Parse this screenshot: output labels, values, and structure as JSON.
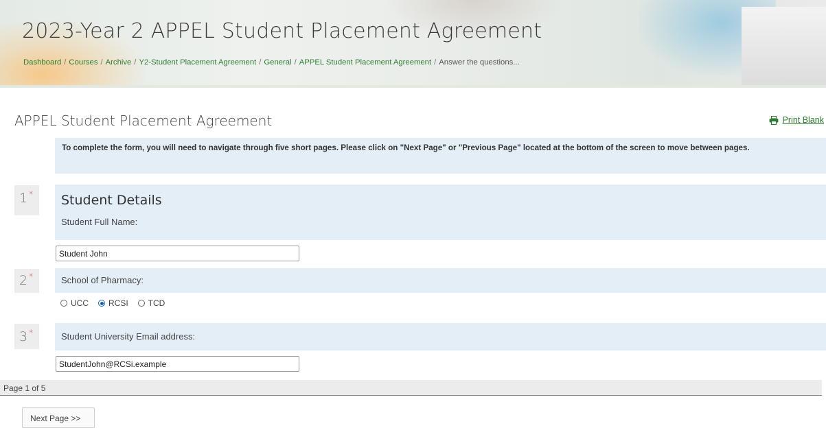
{
  "header": {
    "title": "2023-Year 2 APPEL Student Placement Agreement",
    "breadcrumb": [
      "Dashboard",
      "Courses",
      "Archive",
      "Y2-Student Placement Agreement",
      "General",
      "APPEL Student Placement Agreement",
      "Answer the questions..."
    ],
    "separator": "/"
  },
  "section": {
    "title": "APPEL Student Placement Agreement",
    "print_label": "Print Blank",
    "print_icon": "printer-icon",
    "intro": "To complete the form, you will need to navigate through five short pages. Please click on \"Next Page\" or \"Previous Page\" located at the bottom of the screen to move between pages."
  },
  "questions": [
    {
      "number": "1",
      "required": "*",
      "heading": "Student Details",
      "label": "Student Full Name:",
      "value": "Student John"
    },
    {
      "number": "2",
      "required": "*",
      "label": "School of Pharmacy:",
      "options": [
        "UCC",
        "RCSI",
        "TCD"
      ],
      "selected": "RCSI"
    },
    {
      "number": "3",
      "required": "*",
      "label": "Student University Email address:",
      "value": "StudentJohn@RCSi.example"
    }
  ],
  "pagination": {
    "status": "Page 1 of 5",
    "next_label": "Next Page >>"
  },
  "colors": {
    "accent": "#2e7d32",
    "question_bg": "#e3eef6",
    "required": "#d32f2f",
    "radio_selected": "#1565c0"
  }
}
